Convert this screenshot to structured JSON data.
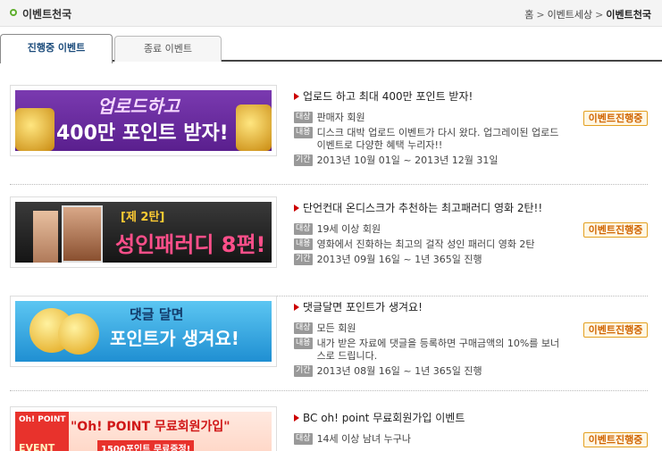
{
  "header": {
    "title": "이벤트천국",
    "breadcrumb": [
      "홈",
      "이벤트세상",
      "이벤트천국"
    ],
    "separator": ">"
  },
  "tabs": [
    {
      "label": "진행중 이벤트",
      "active": true
    },
    {
      "label": "종료 이벤트",
      "active": false
    }
  ],
  "labels": {
    "target": "대상",
    "content": "내용",
    "period": "기간"
  },
  "events": [
    {
      "headline": "업로드 하고 최대 400만 포인트 받자!",
      "banner_lines": [
        "업로드하고",
        "400만 포인트 받자!"
      ],
      "target": "판매자 회원",
      "content": "디스크 대박 업로드 이벤트가 다시 왔다. 업그레이된 업로드 이벤트로 다양한 혜택 누리자!!",
      "period": "2013년 10월 01일 ~ 2013년 12월 31일",
      "badge": "이벤트진행중"
    },
    {
      "headline": "단언컨대 온디스크가 추천하는 최고패러디 영화 2탄!!",
      "banner_lines": [
        "[제 2탄]",
        "성인패러디 8편!"
      ],
      "target": "19세 이상 회원",
      "content": "영화에서 진화하는 최고의 걸작 성인 패러디 영화 2탄",
      "period": "2013년 09월 16일 ~ 1년 365일 진행",
      "badge": "이벤트진행중"
    },
    {
      "headline": "댓글달면 포인트가 생겨요!",
      "banner_lines": [
        "댓글 달면",
        "포인트가 생겨요!"
      ],
      "target": "모든 회원",
      "content": "내가 받은 자료에 댓글을 등록하면 구매금액의 10%를 보너스로 드립니다.",
      "period": "2013년 08월 16일 ~ 1년 365일 진행",
      "badge": "이벤트진행중"
    },
    {
      "headline": "BC oh! point 무료회원가입 이벤트",
      "banner_lines": [
        "Oh! POINT",
        "EVENT",
        "\"Oh! POINT 무료회원가입\"",
        "1500포인트 무료증정!"
      ],
      "target": "14세 이상 남녀 누구나",
      "content": "",
      "period": "",
      "badge": "이벤트진행중"
    }
  ],
  "colors": {
    "accent_green": "#5fae2e",
    "badge_orange": "#d06400",
    "arrow_red": "#cc0000"
  }
}
